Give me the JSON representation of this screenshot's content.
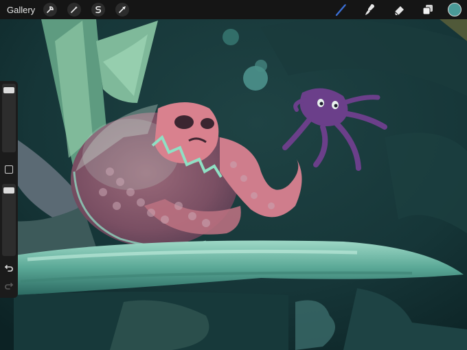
{
  "toolbar": {
    "gallery_label": "Gallery",
    "left_tools": [
      "actions-icon",
      "adjustments-icon",
      "selection-icon",
      "transform-icon"
    ],
    "right_tools": [
      "brush-icon",
      "smudge-icon",
      "eraser-icon",
      "layers-icon"
    ],
    "active_tool": "brush-icon",
    "current_color": "#4a9a98",
    "active_color": "#3b6fd6"
  },
  "sidebar": {
    "brush_size_level": 0.05,
    "opacity_level": 0.05,
    "icons": [
      "modify-square-icon",
      "undo-icon",
      "redo-icon"
    ]
  }
}
